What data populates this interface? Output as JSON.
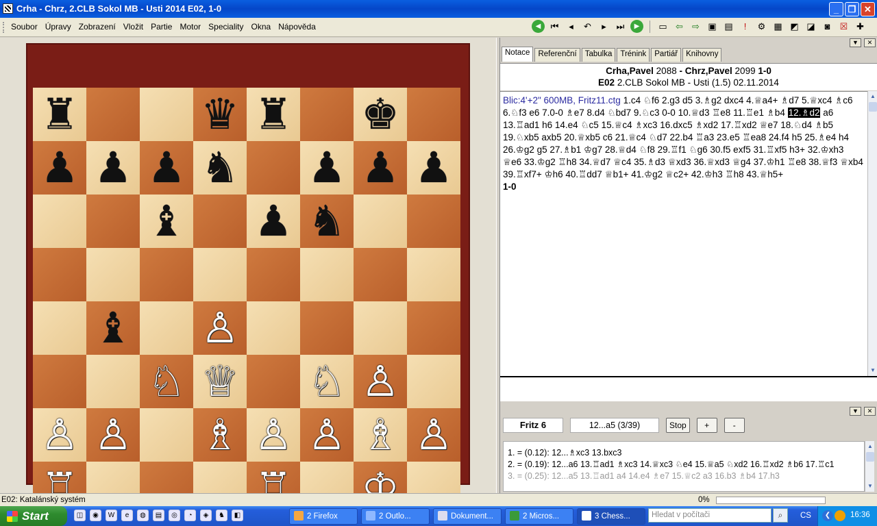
{
  "window": {
    "title": "Crha - Chrz, 2.CLB Sokol MB - Usti 2014  E02, 1-0",
    "btn_minimize": "_",
    "btn_maximize": "❐",
    "btn_close": "✕"
  },
  "menu": {
    "items": [
      "Soubor",
      "Úpravy",
      "Zobrazení",
      "Vložit",
      "Partie",
      "Motor",
      "Speciality",
      "Okna",
      "Nápověda"
    ]
  },
  "toolbar": {
    "icons": [
      {
        "name": "back-green-icon",
        "glyph": "◀"
      },
      {
        "name": "first-move-icon",
        "glyph": "⏮"
      },
      {
        "name": "prev-move-icon",
        "glyph": "◂"
      },
      {
        "name": "take-back-icon",
        "glyph": "↶"
      },
      {
        "name": "next-move-icon",
        "glyph": "▸"
      },
      {
        "name": "last-move-icon",
        "glyph": "⏭"
      },
      {
        "name": "forward-green-icon",
        "glyph": "▶"
      },
      {
        "name": "new-document-icon",
        "glyph": "▭"
      },
      {
        "name": "arrow-left-icon",
        "glyph": "⇦"
      },
      {
        "name": "arrow-right-icon",
        "glyph": "⇨"
      },
      {
        "name": "save-icon",
        "glyph": "▣"
      },
      {
        "name": "save-multiple-icon",
        "glyph": "▤"
      },
      {
        "name": "exclaim-icon",
        "glyph": "!"
      },
      {
        "name": "settings-icon",
        "glyph": "⚙"
      },
      {
        "name": "board-icon",
        "glyph": "▦"
      },
      {
        "name": "eraser-icon",
        "glyph": "◩"
      },
      {
        "name": "eraser2-icon",
        "glyph": "◪"
      },
      {
        "name": "camera-icon",
        "glyph": "◙"
      },
      {
        "name": "delete-icon",
        "glyph": "☒"
      },
      {
        "name": "add-icon",
        "glyph": "✚"
      }
    ]
  },
  "board": {
    "squares": [
      [
        "♜",
        "",
        "",
        "♛",
        "♜",
        "",
        "♚",
        ""
      ],
      [
        "♟",
        "♟",
        "♟",
        "♞",
        "",
        "♟",
        "♟",
        "♟"
      ],
      [
        "",
        "",
        "♝",
        "",
        "♟",
        "♞",
        "",
        ""
      ],
      [
        "",
        "",
        "",
        "",
        "",
        "",
        "",
        ""
      ],
      [
        "",
        "♝",
        "",
        "♙",
        "",
        "",
        "",
        ""
      ],
      [
        "",
        "",
        "♘",
        "♕",
        "",
        "♘",
        "♙",
        ""
      ],
      [
        "♙",
        "♙",
        "",
        "♗",
        "♙",
        "♙",
        "♗",
        "♙"
      ],
      [
        "♖",
        "",
        "",
        "",
        "♖",
        "",
        "♔",
        ""
      ]
    ],
    "colors": {
      "light": "#f0d6a6",
      "dark": "#c46a33",
      "frame": "#7a1d16"
    }
  },
  "tabs": [
    "Notace",
    "Referenční",
    "Tabulka",
    "Trénink",
    "Partiář",
    "Knihovny"
  ],
  "game_header": {
    "white": "Crha,Pavel",
    "white_elo": "2088",
    "dash": "-",
    "black": "Chrz,Pavel",
    "black_elo": "2099",
    "result": "1-0",
    "eco": "E02",
    "event": "2.CLB Sokol MB - Usti (1.5) 02.11.2014"
  },
  "notation": {
    "meta": "Blic:4'+2\"   600MB, Fritz11.ctg",
    "before_current": "1.c4  ♘f6  2.g3  d5  3.♗g2  dxc4  4.♕a4+  ♗d7  5.♕xc4  ♗c6  6.♘f3  e6  7.0-0  ♗e7  8.d4  ♘bd7  9.♘c3  0-0  10.♕d3  ♖e8  11.♖e1  ♗b4 ",
    "current": "12.♗d2",
    "after_current": " a6  13.♖ad1  h6  14.e4  ♘c5  15.♕c4  ♗xc3  16.dxc5  ♗xd2  17.♖xd2  ♕e7  18.♘d4  ♗b5  19.♘xb5  axb5  20.♕xb5  c6  21.♕c4  ♘d7  22.b4  ♖a3  23.e5  ♖ea8  24.f4  h5  25.♗e4  h4  26.♔g2  g5  27.♗b1  ♔g7  28.♕d4  ♘f8  29.♖f1  ♘g6  30.f5  exf5  31.♖xf5  h3+  32.♔xh3  ♕e6  33.♔g2  ♖h8  34.♕d7  ♕c4  35.♗d3  ♕xd3  36.♕xd3  ♕g4  37.♔h1  ♖e8  38.♕f3  ♕xb4  39.♖xf7+  ♔h6  40.♖dd7  ♕b1+  41.♔g2  ♕c2+  42.♔h3  ♖h8  43.♕h5+",
    "result": "1-0"
  },
  "engine": {
    "name": "Fritz 6",
    "move": "12...a5 (3/39)",
    "stop_label": "Stop",
    "plus_label": "+",
    "minus_label": "-",
    "lines": [
      "1. =  (0.12): 12...♗xc3 13.bxc3",
      "2. =  (0.19): 12...a6 13.♖ad1 ♗xc3 14.♕xc3 ♘e4 15.♕a5 ♘xd2 16.♖xd2 ♗b6 17.♖c1",
      "3. =  (0.25): 12...a5 13.♖ad1 a4 14.e4 ♗e7 15.♕c2 a3 16.b3 ♗b4 17.h3"
    ]
  },
  "status": {
    "opening": "E02: Katalánský systém",
    "progress_label": "0%",
    "progress_value": 0
  },
  "taskbar": {
    "start": "Start",
    "tasks": [
      "2 Firefox",
      "2 Outlo...",
      "Dokument...",
      "2 Micros...",
      "3 Chess..."
    ],
    "search_placeholder": "Hledat v počítači",
    "lang": "CS",
    "clock": "16:36"
  }
}
